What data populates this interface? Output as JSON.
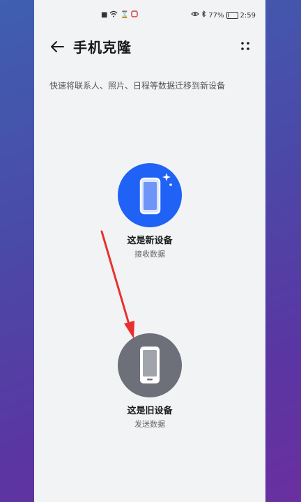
{
  "status_bar": {
    "battery_percent": "77%",
    "battery_level": 77,
    "time": "2:59",
    "icons": [
      "alert-icon",
      "wifi-icon",
      "hourglass-icon",
      "notification-icon",
      "eye-icon",
      "bluetooth-icon",
      "battery-icon"
    ]
  },
  "header": {
    "title": "手机克隆"
  },
  "subtitle": "快速将联系人、照片、日程等数据迁移到新设备",
  "new_device": {
    "label": "这是新设备",
    "sub": "接收数据"
  },
  "old_device": {
    "label": "这是旧设备",
    "sub": "发送数据"
  },
  "colors": {
    "new_device_circle": "#1f62f5",
    "old_device_circle": "#6d6f79",
    "annotation_arrow": "#e8312f",
    "screen_bg": "#f1f3f5"
  }
}
